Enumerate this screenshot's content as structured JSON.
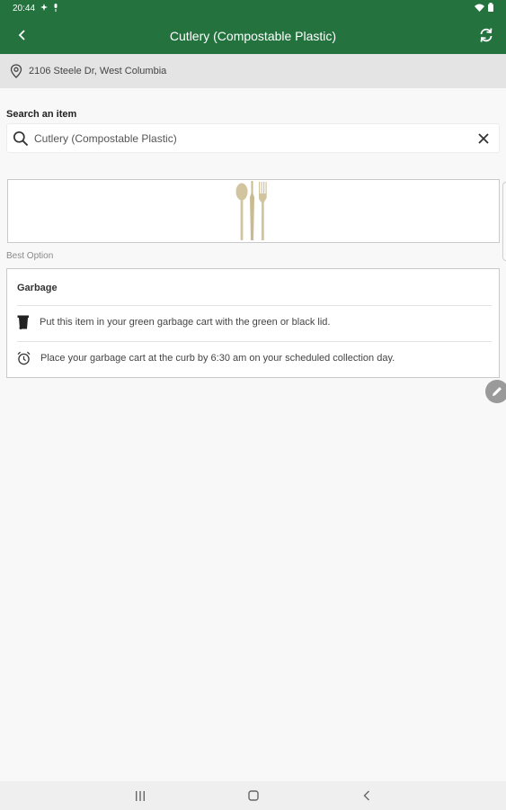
{
  "status_bar": {
    "time": "20:44",
    "icons": [
      "notification-icon",
      "mic-icon",
      "wifi-icon",
      "battery-icon"
    ]
  },
  "app_bar": {
    "title": "Cutlery (Compostable Plastic)",
    "back_icon": "chevron-left-icon",
    "refresh_icon": "refresh-icon",
    "color": "#24733f"
  },
  "address": {
    "text": "2106 Steele Dr, West Columbia",
    "icon": "location-pin-icon"
  },
  "search": {
    "label": "Search an item",
    "value": "Cutlery (Compostable Plastic)",
    "search_icon": "search-icon",
    "clear_icon": "close-icon"
  },
  "item": {
    "image_icon": "cutlery-icon"
  },
  "result": {
    "option_label": "Best Option",
    "heading": "Garbage",
    "instructions": [
      {
        "icon": "garbage-cart-icon",
        "text": "Put this item in your green garbage cart with the green or black lid."
      },
      {
        "icon": "alarm-clock-icon",
        "text": "Place your garbage cart at the curb by 6:30 am on your scheduled collection day."
      }
    ]
  },
  "fab_icon": "pencil-icon",
  "nav_bar": {
    "icons": [
      "recents-icon",
      "home-icon",
      "back-icon"
    ]
  }
}
